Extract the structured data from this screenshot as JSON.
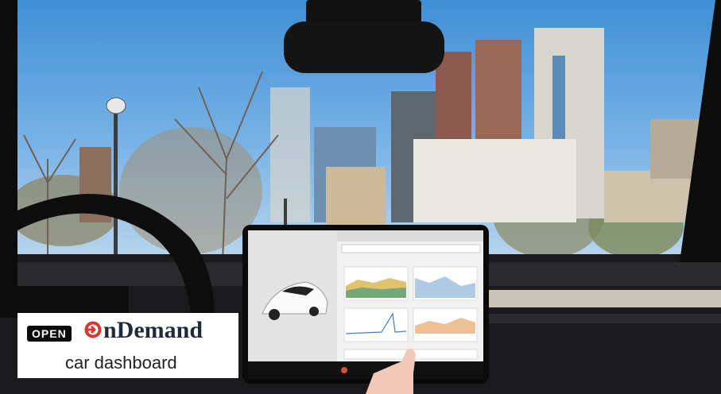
{
  "overlay": {
    "open_badge": "OPEN",
    "brand_name": "nDemand",
    "subtitle": "car dashboard"
  },
  "colors": {
    "brand_red": "#d63a2f",
    "badge_bg": "#0b0b0b",
    "sky_top": "#3f8fd6"
  },
  "tablet": {
    "content": "web dashboard with four line-chart panels shown on the in-car touchscreen"
  }
}
